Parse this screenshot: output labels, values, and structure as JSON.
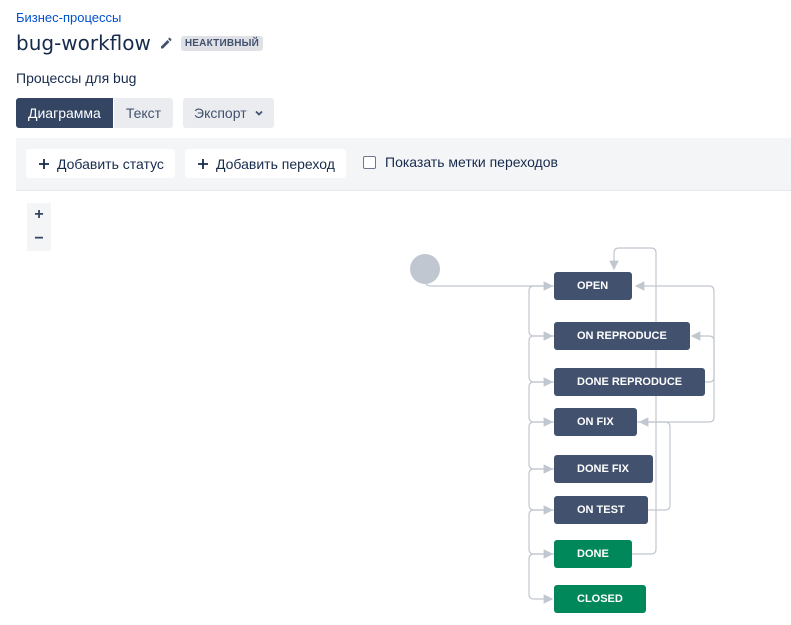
{
  "breadcrumb": "Бизнес-процессы",
  "workflow": {
    "name": "bug-workflow",
    "status": "НЕАКТИВНЫЙ",
    "subtitle": "Процессы для bug"
  },
  "view_tabs": {
    "diagram": "Диаграмма",
    "text": "Текст",
    "export": "Экспорт"
  },
  "toolbar": {
    "add_status": "Добавить статус",
    "add_transition": "Добавить переход",
    "show_labels": "Показать метки переходов",
    "show_labels_checked": false
  },
  "zoom": {
    "in": "+",
    "out": "−"
  },
  "statuses": [
    {
      "label": "OPEN",
      "color": "#42526e"
    },
    {
      "label": "ON REPRODUCE",
      "color": "#42526e"
    },
    {
      "label": "DONE REPRODUCE",
      "color": "#42526e"
    },
    {
      "label": "ON FIX",
      "color": "#42526e"
    },
    {
      "label": "DONE FIX",
      "color": "#42526e"
    },
    {
      "label": "ON TEST",
      "color": "#42526e"
    },
    {
      "label": "DONE",
      "color": "#00875a"
    },
    {
      "label": "CLOSED",
      "color": "#00875a"
    }
  ],
  "colors": {
    "link": "#0052cc",
    "primary_dark": "#344563",
    "status_blue": "#42526e",
    "status_green": "#00875a",
    "connector": "#c1c7d0"
  }
}
